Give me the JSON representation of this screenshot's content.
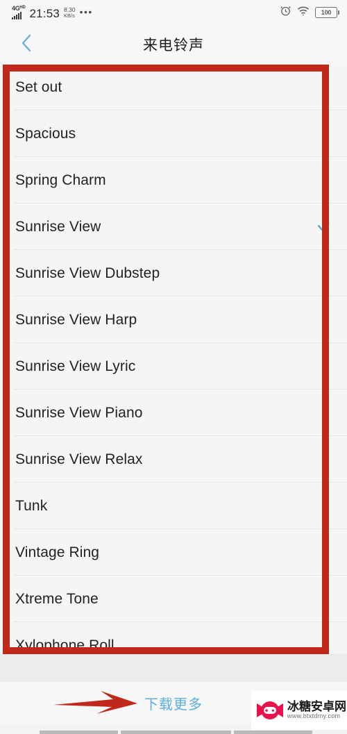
{
  "status_bar": {
    "network_label": "4G",
    "network_sup": "HD",
    "signal_icon": "signal-bars-icon",
    "time": "21:53",
    "data_rate_value": "8.30",
    "data_rate_unit": "KB/s",
    "overflow": "•••",
    "alarm_icon": "alarm-clock-icon",
    "wifi_icon": "wifi-icon",
    "battery_level": "100"
  },
  "header": {
    "back_icon": "back-chevron-icon",
    "title": "来电铃声"
  },
  "ringtones": {
    "selected": "Sunrise View",
    "check_icon": "check-mark-icon",
    "items": [
      {
        "label": "Set out",
        "checked": false
      },
      {
        "label": "Spacious",
        "checked": false
      },
      {
        "label": "Spring Charm",
        "checked": false
      },
      {
        "label": "Sunrise View",
        "checked": true
      },
      {
        "label": "Sunrise View Dubstep",
        "checked": false
      },
      {
        "label": "Sunrise View Harp",
        "checked": false
      },
      {
        "label": "Sunrise View Lyric",
        "checked": false
      },
      {
        "label": "Sunrise View Piano",
        "checked": false
      },
      {
        "label": "Sunrise View Relax",
        "checked": false
      },
      {
        "label": "Tunk",
        "checked": false
      },
      {
        "label": "Vintage Ring",
        "checked": false
      },
      {
        "label": "Xtreme Tone",
        "checked": false
      },
      {
        "label": "Xylophone Roll",
        "checked": false
      }
    ]
  },
  "footer": {
    "download_more": "下载更多"
  },
  "annotations": {
    "box_color": "#c0281c",
    "arrow_color": "#c0281c",
    "box_name": "ringtone-list-highlight",
    "arrow_name": "download-more-arrow"
  },
  "watermark": {
    "logo_icon": "candy-gamepad-logo-icon",
    "site_name": "冰糖安卓网",
    "site_url": "www.btxtdmy.com"
  },
  "nav_bar": {
    "icon": "android-nav-bar"
  },
  "theme": {
    "accent_blue": "#5aaee0",
    "text_primary": "#222222",
    "page_bg": "#f5f5f5"
  }
}
